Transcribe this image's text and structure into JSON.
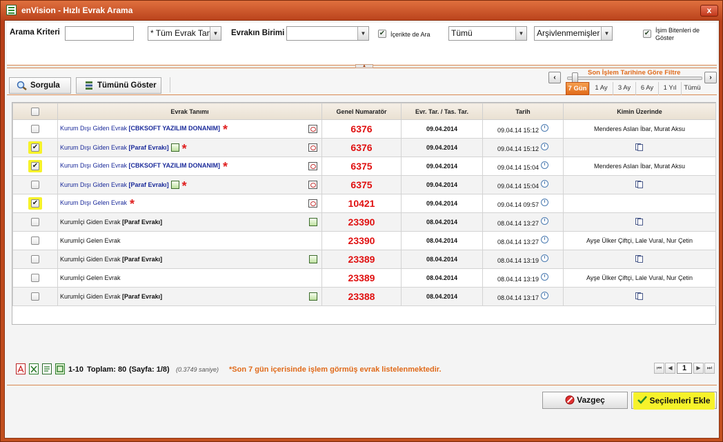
{
  "window": {
    "title": "enVision - Hızlı Evrak Arama",
    "close": "x"
  },
  "criteria": {
    "arama_kriteri_label": "Arama Kriteri",
    "arama_kriteri_value": "",
    "evrak_type_value": "* Tüm Evrak Tan",
    "evrak_birimi_label": "Evrakın Birimi",
    "evrak_birimi_value": "",
    "icerikte_ara_label": "İçerikte de Ara",
    "tumu_value": "Tümü",
    "arsiv_value": "Arşivlenmemişler",
    "isim_biten_label": "İşim Bitenleri de Göster"
  },
  "toolbar": {
    "sorgula": "Sorgula",
    "tumunu_goster": "Tümünü Göster",
    "filter_title": "Son İşlem Tarihine Göre Filtre",
    "ranges": [
      "7 Gün",
      "1 Ay",
      "3 Ay",
      "6 Ay",
      "1 Yıl",
      "Tümü"
    ],
    "active_range": "7 Gün"
  },
  "grid": {
    "headers": [
      "Evrak Tanımı",
      "Genel Numaratör",
      "Evr. Tar. / Tas. Tar.",
      "Tarih",
      "Kimin Üzerinde"
    ],
    "rows": [
      {
        "checked": false,
        "highlight": false,
        "type": "Kurum Dışı Giden Evrak",
        "tag": "[CBKSOFT YAZILIM DONANIM]",
        "internal": false,
        "pico": false,
        "star": true,
        "view": true,
        "num": "6376",
        "evr": "09.04.2014",
        "tarih": "09.04.14 15:12",
        "kimin": "Menderes Aslan İbar, Murat Aksu",
        "docs": false
      },
      {
        "checked": true,
        "highlight": true,
        "type": "Kurum Dışı Giden Evrak",
        "tag": "[Paraf Evrakı]",
        "internal": false,
        "pico": true,
        "star": true,
        "view": true,
        "num": "6376",
        "evr": "09.04.2014",
        "tarih": "09.04.14 15:12",
        "kimin": "",
        "docs": true
      },
      {
        "checked": true,
        "highlight": true,
        "type": "Kurum Dışı Giden Evrak",
        "tag": "[CBKSOFT YAZILIM DONANIM]",
        "internal": false,
        "pico": false,
        "star": true,
        "view": true,
        "num": "6375",
        "evr": "09.04.2014",
        "tarih": "09.04.14 15:04",
        "kimin": "Menderes Aslan İbar, Murat Aksu",
        "docs": false
      },
      {
        "checked": false,
        "highlight": false,
        "type": "Kurum Dışı Giden Evrak",
        "tag": "[Paraf Evrakı]",
        "internal": false,
        "pico": true,
        "star": true,
        "view": true,
        "num": "6375",
        "evr": "09.04.2014",
        "tarih": "09.04.14 15:04",
        "kimin": "",
        "docs": true
      },
      {
        "checked": true,
        "highlight": true,
        "type": "Kurum Dışı Gelen Evrak",
        "tag": "",
        "internal": false,
        "pico": false,
        "star": true,
        "view": true,
        "num": "10421",
        "evr": "09.04.2014",
        "tarih": "09.04.14 09:57",
        "kimin": "",
        "docs": false
      },
      {
        "checked": false,
        "highlight": false,
        "type": "Kurumİçi Giden Evrak",
        "tag": "[Paraf Evrakı]",
        "internal": true,
        "pico": "right",
        "star": false,
        "view": false,
        "num": "23390",
        "evr": "08.04.2014",
        "tarih": "08.04.14 13:27",
        "kimin": "",
        "docs": true
      },
      {
        "checked": false,
        "highlight": false,
        "type": "Kurumİçi Gelen Evrak",
        "tag": "",
        "internal": true,
        "pico": false,
        "star": false,
        "view": false,
        "num": "23390",
        "evr": "08.04.2014",
        "tarih": "08.04.14 13:27",
        "kimin": "Ayşe Ülker Çiftçi, Lale Vural, Nur Çetin",
        "docs": false
      },
      {
        "checked": false,
        "highlight": false,
        "type": "Kurumİçi Giden Evrak",
        "tag": "[Paraf Evrakı]",
        "internal": true,
        "pico": "right",
        "star": false,
        "view": false,
        "num": "23389",
        "evr": "08.04.2014",
        "tarih": "08.04.14 13:19",
        "kimin": "",
        "docs": true
      },
      {
        "checked": false,
        "highlight": false,
        "type": "Kurumİçi Gelen Evrak",
        "tag": "",
        "internal": true,
        "pico": false,
        "star": false,
        "view": false,
        "num": "23389",
        "evr": "08.04.2014",
        "tarih": "08.04.14 13:19",
        "kimin": "Ayşe Ülker Çiftçi, Lale Vural, Nur Çetin",
        "docs": false
      },
      {
        "checked": false,
        "highlight": false,
        "type": "Kurumİçi Giden Evrak",
        "tag": "[Paraf Evrakı]",
        "internal": true,
        "pico": "right",
        "star": false,
        "view": false,
        "num": "23388",
        "evr": "08.04.2014",
        "tarih": "08.04.14 13:17",
        "kimin": "",
        "docs": true
      }
    ]
  },
  "footer": {
    "range": "1-10",
    "toplam": "Toplam: 80",
    "sayfa": "(Sayfa: 1/8)",
    "timing": "(0.3749 saniye)",
    "notice": "*Son 7 gün içerisinde işlem görmüş evrak listelenmektedir.",
    "page_input": "1"
  },
  "buttons": {
    "vazgec": "Vazgeç",
    "secilenleri_ekle": "Seçilenleri Ekle"
  },
  "colors": {
    "accent": "#e06a1a",
    "number": "#e01010",
    "highlight": "#f6f22a",
    "link": "#1a2a9a"
  }
}
